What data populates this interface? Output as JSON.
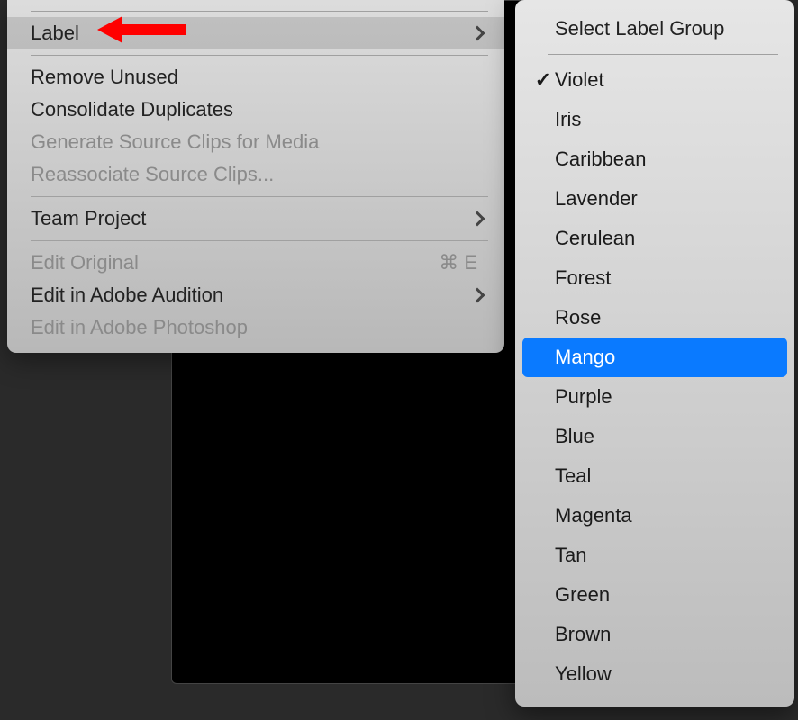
{
  "main_menu": {
    "items": [
      {
        "label": "Label",
        "hasSubmenu": true,
        "highlighted": true
      },
      {
        "sep": true
      },
      {
        "label": "Remove Unused"
      },
      {
        "label": "Consolidate Duplicates"
      },
      {
        "label": "Generate Source Clips for Media",
        "disabled": true
      },
      {
        "label": "Reassociate Source Clips...",
        "disabled": true
      },
      {
        "sep": true
      },
      {
        "label": "Team Project",
        "hasSubmenu": true
      },
      {
        "sep": true
      },
      {
        "label": "Edit Original",
        "disabled": true,
        "shortcut": "⌘ E"
      },
      {
        "label": "Edit in Adobe Audition",
        "hasSubmenu": true
      },
      {
        "label": "Edit in Adobe Photoshop",
        "disabled": true
      }
    ]
  },
  "sub_menu": {
    "header": "Select Label Group",
    "items": [
      {
        "label": "Violet",
        "checked": true
      },
      {
        "label": "Iris"
      },
      {
        "label": "Caribbean"
      },
      {
        "label": "Lavender"
      },
      {
        "label": "Cerulean"
      },
      {
        "label": "Forest"
      },
      {
        "label": "Rose"
      },
      {
        "label": "Mango",
        "selected": true
      },
      {
        "label": "Purple"
      },
      {
        "label": "Blue"
      },
      {
        "label": "Teal"
      },
      {
        "label": "Magenta"
      },
      {
        "label": "Tan"
      },
      {
        "label": "Green"
      },
      {
        "label": "Brown"
      },
      {
        "label": "Yellow"
      }
    ]
  }
}
